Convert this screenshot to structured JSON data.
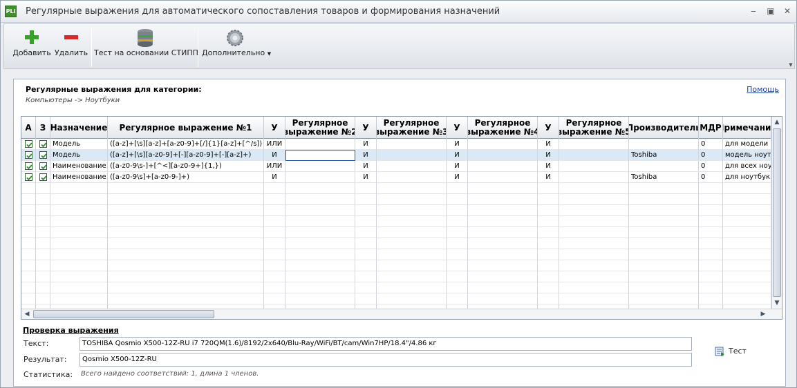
{
  "window": {
    "title": "Регулярные выражения для автоматического сопоставления товаров и формирования назначений",
    "app_icon_text": "PLi"
  },
  "toolbar": {
    "add_label": "Добавить",
    "delete_label": "Удалить",
    "test_label": "Тест на основании СТИПП",
    "more_label": "Дополнительно"
  },
  "panel": {
    "category_title": "Регулярные выражения для категории:",
    "category_path": "Компьютеры -> Ноутбуки",
    "help_label": "Помощь"
  },
  "grid": {
    "columns": [
      "А",
      "З",
      "Назначение",
      "Регулярное выражение №1",
      "У",
      "Регулярное\nвыражение №2",
      "У",
      "Регулярное\nвыражение №3",
      "У",
      "Регулярное\nвыражение №4",
      "У",
      "Регулярное\nвыражение №5",
      "Производитель",
      "МДР",
      "Примечание"
    ],
    "rows": [
      {
        "a": true,
        "z": true,
        "purpose": "Модель",
        "regex1": "([a-z]+[\\s][a-z]+[a-z0-9]+[/]{1}[a-z]+[^/s])",
        "op1": "ИЛИ",
        "regex2": "",
        "op2": "И",
        "regex3": "",
        "op3": "И",
        "regex4": "",
        "op4": "И",
        "regex5": "",
        "manufacturer": "",
        "mdr": "0",
        "note": "для модели"
      },
      {
        "a": true,
        "z": true,
        "purpose": "Модель",
        "regex1": "([a-z]+[\\s][a-z0-9]+[-][a-z0-9]+[-][a-z]+)",
        "op1": "И",
        "regex2": "",
        "op2": "И",
        "regex3": "",
        "op3": "И",
        "regex4": "",
        "op4": "И",
        "regex5": "",
        "manufacturer": "Toshiba",
        "mdr": "0",
        "note": "модель ноут"
      },
      {
        "a": true,
        "z": true,
        "purpose": "Наименование",
        "regex1": "([a-z0-9\\s-]+[^<][a-z0-9+]{1,})",
        "op1": "ИЛИ",
        "regex2": "",
        "op2": "И",
        "regex3": "",
        "op3": "И",
        "regex4": "",
        "op4": "И",
        "regex5": "",
        "manufacturer": "",
        "mdr": "0",
        "note": "для всех ноу"
      },
      {
        "a": true,
        "z": true,
        "purpose": "Наименование",
        "regex1": "([a-z0-9\\s]+[a-z0-9-]+)",
        "op1": "И",
        "regex2": "",
        "op2": "И",
        "regex3": "",
        "op3": "И",
        "regex4": "",
        "op4": "И",
        "regex5": "",
        "manufacturer": "Toshiba",
        "mdr": "0",
        "note": "для ноутбук"
      }
    ],
    "selected_row": 1
  },
  "test": {
    "section_title": "Проверка выражения",
    "text_label": "Текст:",
    "text_value": "TOSHIBA Qosmio X500-12Z-RU i7 720QM(1.6)/8192/2x640/Blu-Ray/WiFi/BT/cam/Win7HP/18.4\"/4.86 кг",
    "result_label": "Результат:",
    "result_value": "Qosmio X500-12Z-RU",
    "stats_label": "Статистика:",
    "stats_value": "Всего найдено соответствий: 1, длина 1 членов.",
    "test_button_label": "Тест"
  },
  "colors": {
    "check_green": "#2f8a2f",
    "selection": "#dbe8f6",
    "link": "#1a3fa0"
  }
}
